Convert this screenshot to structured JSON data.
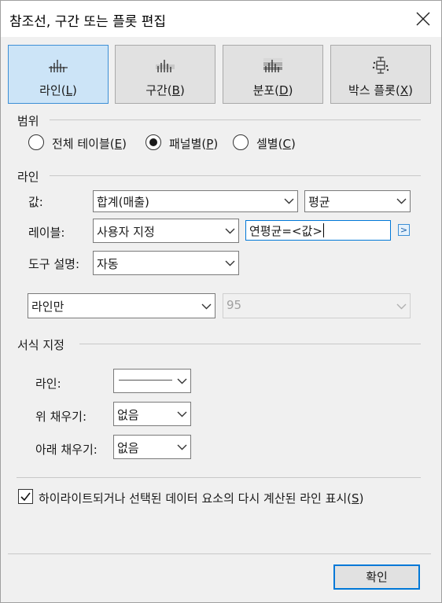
{
  "window": {
    "title": "참조선, 구간 또는 플롯 편집"
  },
  "tabs": [
    {
      "label": "라인(",
      "key": "L",
      "suffix": ")",
      "active": true,
      "icon": "reference-line-icon"
    },
    {
      "label": "구간(",
      "key": "B",
      "suffix": ")",
      "active": false,
      "icon": "reference-band-icon"
    },
    {
      "label": "분포(",
      "key": "D",
      "suffix": ")",
      "active": false,
      "icon": "distribution-band-icon"
    },
    {
      "label": "박스 플롯(",
      "key": "X",
      "suffix": ")",
      "active": false,
      "icon": "box-plot-icon"
    }
  ],
  "scope": {
    "title": "범위",
    "options": [
      {
        "label": "전체 테이블(",
        "key": "E",
        "suffix": ")",
        "checked": false
      },
      {
        "label": "패널별(",
        "key": "P",
        "suffix": ")",
        "checked": true
      },
      {
        "label": "셀별(",
        "key": "C",
        "suffix": ")",
        "checked": false
      }
    ]
  },
  "line": {
    "title": "라인",
    "value_label": "값:",
    "value_field": "합계(매출)",
    "aggregation": "평균",
    "label_label": "레이블:",
    "label_type": "사용자 지정",
    "label_text": "연평균=<값>",
    "insert_button": ">",
    "tooltip_label": "도구 설명:",
    "tooltip_value": "자동",
    "line_mode": "라인만",
    "confidence": "95"
  },
  "formatting": {
    "title": "서식 지정",
    "line_label": "라인:",
    "fill_above_label": "위 채우기:",
    "fill_above_value": "없음",
    "fill_below_label": "아래 채우기:",
    "fill_below_value": "없음"
  },
  "recalc": {
    "label": "하이라이트되거나 선택된 데이터 요소의 다시 계산된 라인 표시(",
    "key": "S",
    "suffix": ")",
    "checked": true
  },
  "ok_button": "확인",
  "colors": {
    "accent": "#0078d7",
    "active_tab": "#cce4f7"
  }
}
